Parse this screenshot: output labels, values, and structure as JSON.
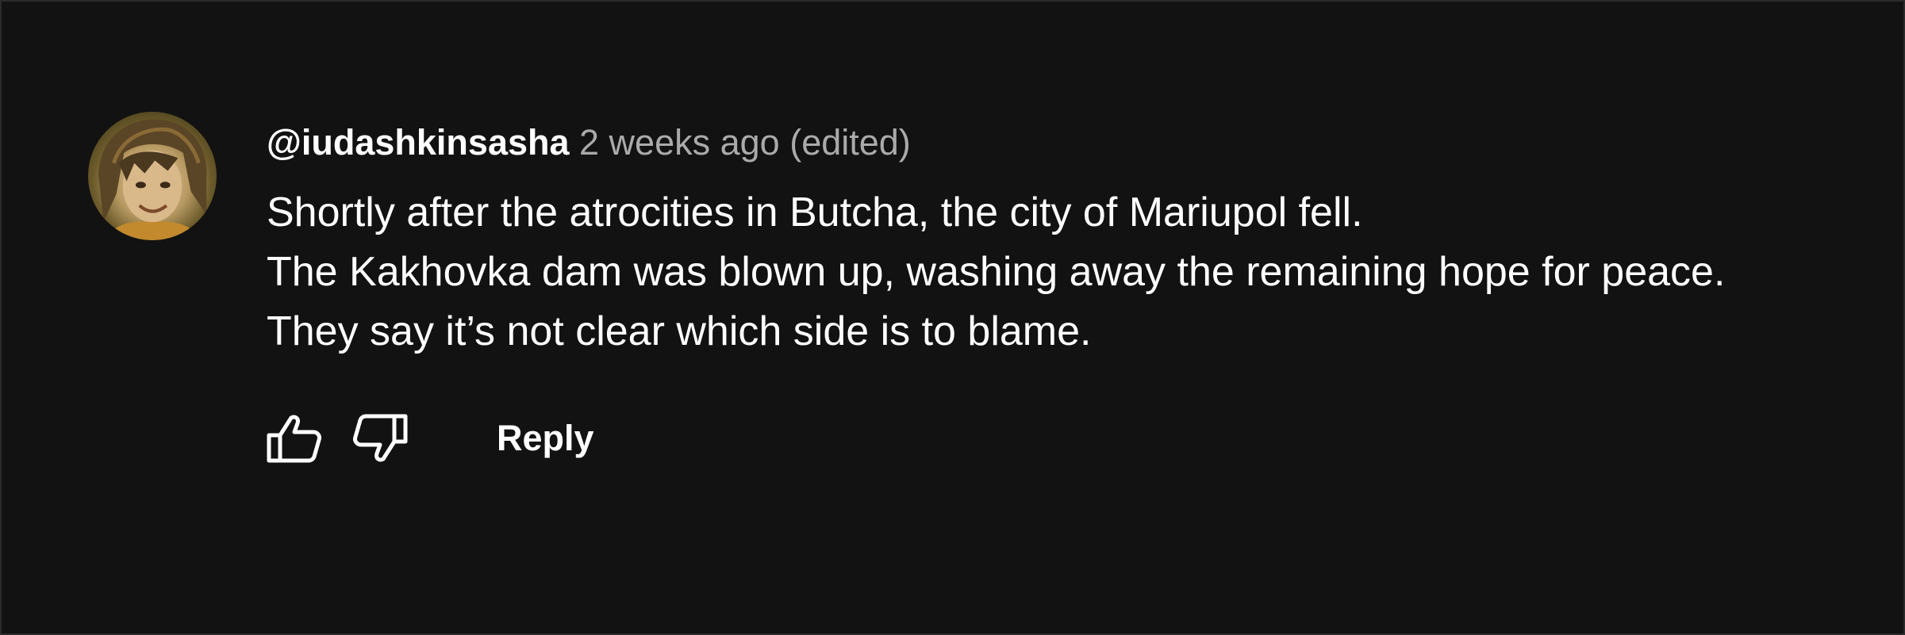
{
  "comment": {
    "author": "@iudashkinsasha",
    "time": "2 weeks ago",
    "edited": "(edited)",
    "lines": [
      "Shortly after the atrocities in Butcha, the city of Mariupol fell.",
      "The Kakhovka dam was blown up, washing away the remaining hope for peace.",
      "They say it’s not clear which side is to blame."
    ]
  },
  "actions": {
    "like_icon": "thumbs-up-icon",
    "dislike_icon": "thumbs-down-icon",
    "reply_label": "Reply"
  },
  "colors": {
    "background": "#121212",
    "text": "#ffffff",
    "secondary_text": "#aaaaaa"
  }
}
